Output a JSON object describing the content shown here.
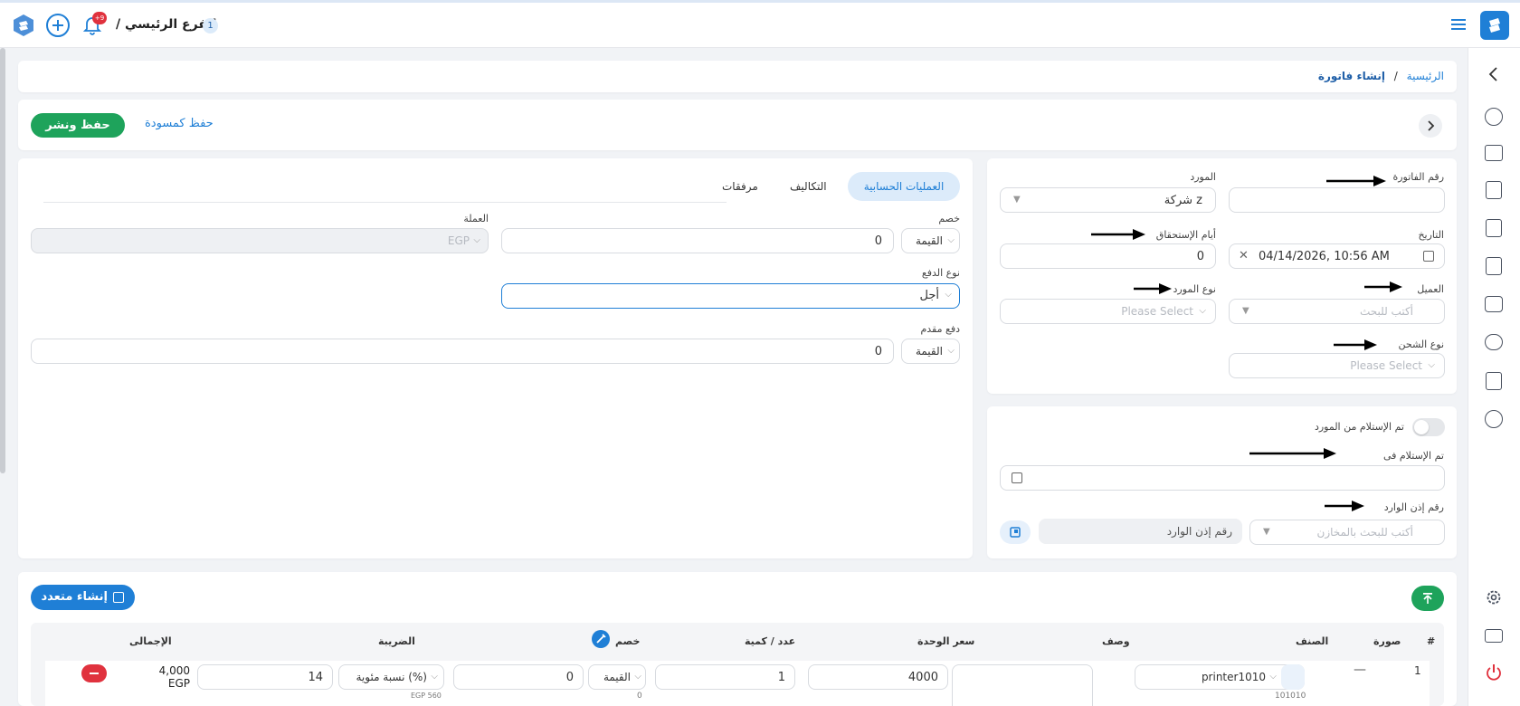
{
  "topbar": {
    "branch_count": "1",
    "branch_label": "الفرع الرئيسي /",
    "notification_badge": "+9"
  },
  "breadcrumb": {
    "home": "الرئيسية",
    "separator": "/",
    "current": "إنشاء فاتورة"
  },
  "actions": {
    "publish_label": "حفظ ونشر",
    "draft_label": "حفظ كمسودة"
  },
  "invoice": {
    "invoice_number_label": "رقم الفاتورة",
    "invoice_number_value": "",
    "supplier_label": "المورد",
    "supplier_value": "شركة z",
    "date_label": "التاريخ",
    "date_value": "04/14/2026, 10:56 AM",
    "due_days_label": "أيام الإستحقاق",
    "due_days_value": "0",
    "client_label": "العميل",
    "client_placeholder": "أكتب للبحث",
    "supplier_type_label": "نوع المورد",
    "supplier_type_placeholder": "Please Select",
    "shipping_type_label": "نوع الشحن",
    "shipping_type_placeholder": "Please Select"
  },
  "receipt": {
    "received_toggle_label": "تم الإستلام من المورد",
    "received_at_label": "تم الإستلام فى",
    "received_at_value": "",
    "voucher_label": "رقم إذن الوارد",
    "warehouse_placeholder": "أكتب للبحث بالمخازن",
    "voucher_placeholder": "رقم إذن الوارد"
  },
  "tabs": [
    {
      "label": "العمليات الحسابية",
      "active": true
    },
    {
      "label": "التكاليف",
      "active": false
    },
    {
      "label": "مرفقات",
      "active": false
    }
  ],
  "finance": {
    "discount_label": "خصم",
    "discount_type": "القيمة",
    "discount_value": "0",
    "currency_label": "العملة",
    "currency_value": "EGP",
    "payment_type_label": "نوع الدفع",
    "payment_type_value": "أجل",
    "advance_label": "دفع مقدم",
    "advance_type": "القيمة",
    "advance_value": "0"
  },
  "items": {
    "create_multiple_label": "إنشاء متعدد",
    "columns": {
      "num": "#",
      "image": "صورة",
      "item": "الصنف",
      "description": "وصف",
      "unit_price": "سعر الوحدة",
      "qty": "عدد / كمية",
      "discount": "خصم",
      "tax": "الضريبة",
      "total": "الإجمالى"
    },
    "rows": [
      {
        "num": "1",
        "image": "—",
        "item": "printer1010",
        "item_code": "101010",
        "description": "",
        "unit_price": "4000",
        "qty": "1",
        "discount_type": "القيمة",
        "discount_value": "0",
        "discount_sub": "0",
        "tax_type": "نسبة مئوية (%)",
        "tax_value": "14",
        "tax_sub": "EGP 560",
        "total_amount": "4,000",
        "total_currency": "EGP"
      }
    ]
  },
  "colors": {
    "primary": "#1f7fd6",
    "success": "#1ea35b",
    "danger": "#e0323e",
    "tab_active_bg": "#dcebfa"
  }
}
